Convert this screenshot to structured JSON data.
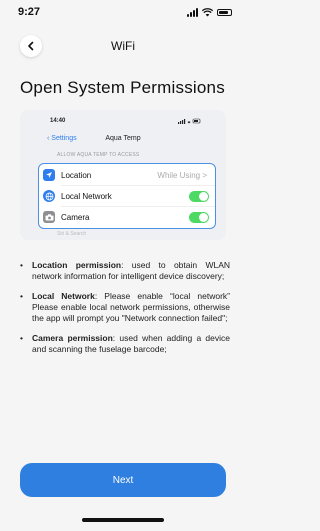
{
  "status_bar": {
    "time": "9:27"
  },
  "header": {
    "title": "WiFi"
  },
  "page": {
    "title": "Open System Permissions"
  },
  "preview": {
    "time": "14:40",
    "back_label": "Settings",
    "app_name": "Aqua Temp",
    "caption": "ALLOW AQUA TEMP TO ACCESS",
    "rows": [
      {
        "label": "Location",
        "value": "While Using >"
      },
      {
        "label": "Local Network"
      },
      {
        "label": "Camera"
      }
    ],
    "faded_item": "Siri & Search"
  },
  "permissions": [
    {
      "bullet": "•",
      "title": "Location permission",
      "text": ": used to obtain WLAN network information for intelligent device discovery;"
    },
    {
      "bullet": "•",
      "title": "Local Network",
      "text": ": Please enable “local network” Please enable local network permissions, otherwise the app will prompt you \"Network connection failed\";"
    },
    {
      "bullet": "•",
      "title": "Camera permission",
      "text": ": used when adding a device and scanning the fuselage barcode;"
    }
  ],
  "footer": {
    "next_label": "Next"
  },
  "colors": {
    "accent": "#2f7fe0",
    "toggle_on": "#4cd964",
    "card_border": "#4a90e2"
  }
}
